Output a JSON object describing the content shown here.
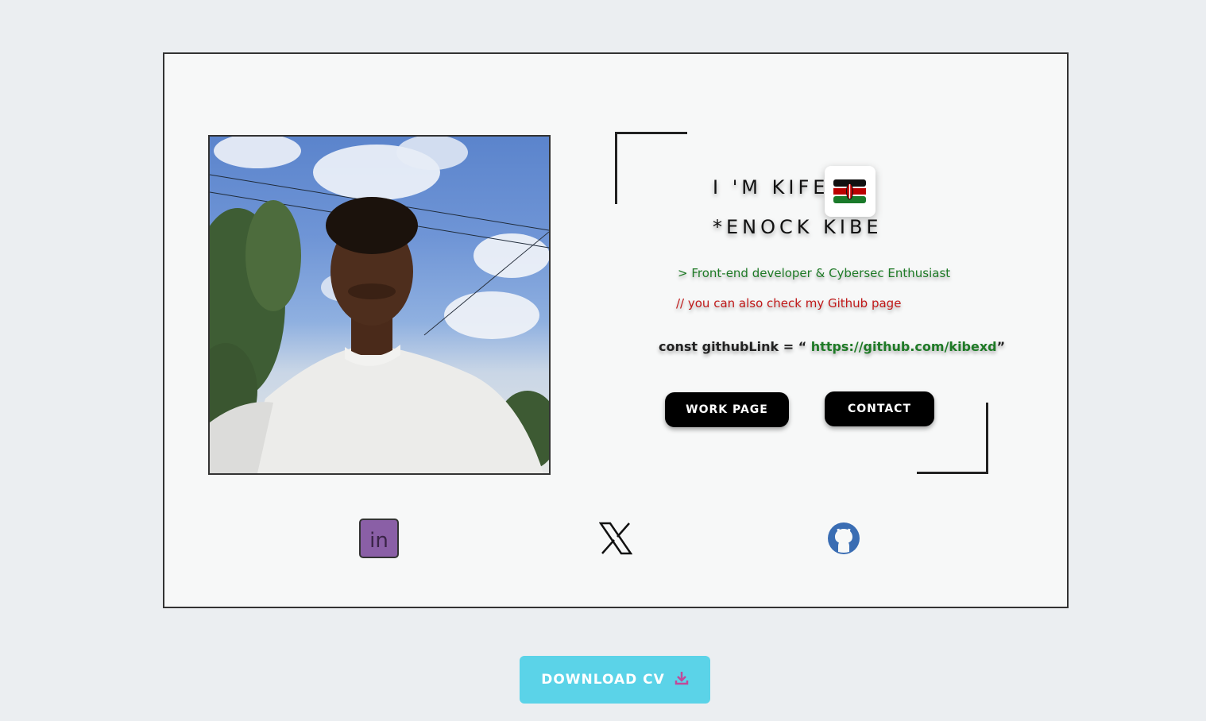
{
  "hero": {
    "greeting": "I 'M KIFE",
    "name": "*ENOCK KIBE",
    "tagline": "> Front-end developer & Cybersec Enthusiast",
    "comment": "// you can also check my Github page",
    "code_prefix": "const githubLink = “",
    "github_url": "https://github.com/kibexd",
    "code_suffix": "”"
  },
  "buttons": {
    "work": "WORK PAGE",
    "contact": "CONTACT",
    "download": "DOWNLOAD CV"
  },
  "social": [
    "linkedin-icon",
    "x-icon",
    "github-icon"
  ],
  "colors": {
    "background": "#ebeef1",
    "card": "#f7f8f8",
    "tagline": "#1e7a26",
    "comment": "#c01818",
    "download": "#5bd3e8",
    "linkedin": "#8a5fa6",
    "github": "#3a6db3"
  }
}
